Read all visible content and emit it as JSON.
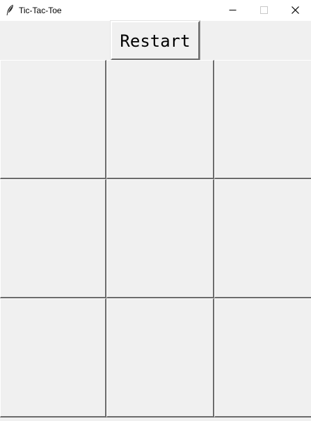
{
  "window": {
    "title": "Tic-Tac-Toe",
    "icon": "feather-icon",
    "controls": {
      "minimize_icon": "minimize-icon",
      "maximize_icon": "maximize-icon",
      "close_icon": "close-icon"
    }
  },
  "toolbar": {
    "restart_label": "Restart"
  },
  "board": {
    "cells": [
      [
        "",
        "",
        ""
      ],
      [
        "",
        "",
        ""
      ],
      [
        "",
        "",
        ""
      ]
    ]
  },
  "colors": {
    "background": "#f0f0f0",
    "titlebar": "#ffffff",
    "cell_shadow": "#6b6b6b"
  }
}
